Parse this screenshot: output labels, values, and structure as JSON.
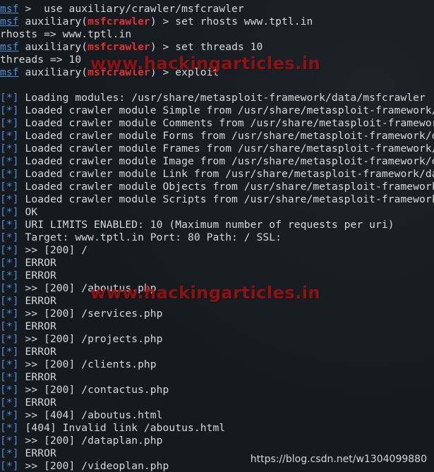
{
  "prompt": "msf",
  "module_prefix": " auxiliary(",
  "module_name": "msfcrawler",
  "module_suffix": ") > ",
  "commands": [
    {
      "first": true,
      "text": " >  use auxiliary/crawler/msfcrawler"
    },
    {
      "text": "set rhosts www.tptl.in"
    },
    {
      "output": "rhosts => www.tptl.in"
    },
    {
      "text": "set threads 10"
    },
    {
      "output": "threads => 10"
    },
    {
      "text": "exploit"
    }
  ],
  "tag": "[*]",
  "log_lines": [
    " Loading modules: /usr/share/metasploit-framework/data/msfcrawler",
    " Loaded crawler module Simple from /usr/share/metasploit-framework/data/msfcrawler",
    " Loaded crawler module Comments from /usr/share/metasploit-framework/data/msfcrawler",
    " Loaded crawler module Forms from /usr/share/metasploit-framework/data/msfcrawler",
    " Loaded crawler module Frames from /usr/share/metasploit-framework/data/msfcrawler",
    " Loaded crawler module Image from /usr/share/metasploit-framework/data/msfcrawler",
    " Loaded crawler module Link from /usr/share/metasploit-framework/data/msfcrawler",
    " Loaded crawler module Objects from /usr/share/metasploit-framework/data/msfcrawler",
    " Loaded crawler module Scripts from /usr/share/metasploit-framework/data/msfcrawler",
    " OK",
    " URI LIMITS ENABLED: 10 (Maximum number of requests per uri)",
    " Target: www.tptl.in Port: 80 Path: / SSL:",
    " >> [200] /",
    " ERROR",
    " ERROR",
    " >> [200] /aboutus.php",
    " ERROR",
    " >> [200] /services.php",
    " ERROR",
    " >> [200] /projects.php",
    " ERROR",
    " >> [200] /clients.php",
    " ERROR",
    " >> [200] /contactus.php",
    " ERROR",
    " >> [404] /aboutus.html",
    " [404] Invalid link /aboutus.html",
    " >> [200] /dataplan.php",
    " ERROR",
    " >> [200] /videoplan.php"
  ],
  "watermark": "www.hackingarticles.in",
  "csdn_watermark": "https://blog.csdn.net/w1304099880",
  "colors": {
    "background": "#151a1f",
    "text": "#d8d8d8",
    "prompt_blue": "#4f8fd9",
    "module_red": "#e03131",
    "watermark_red": "#aa1212"
  }
}
